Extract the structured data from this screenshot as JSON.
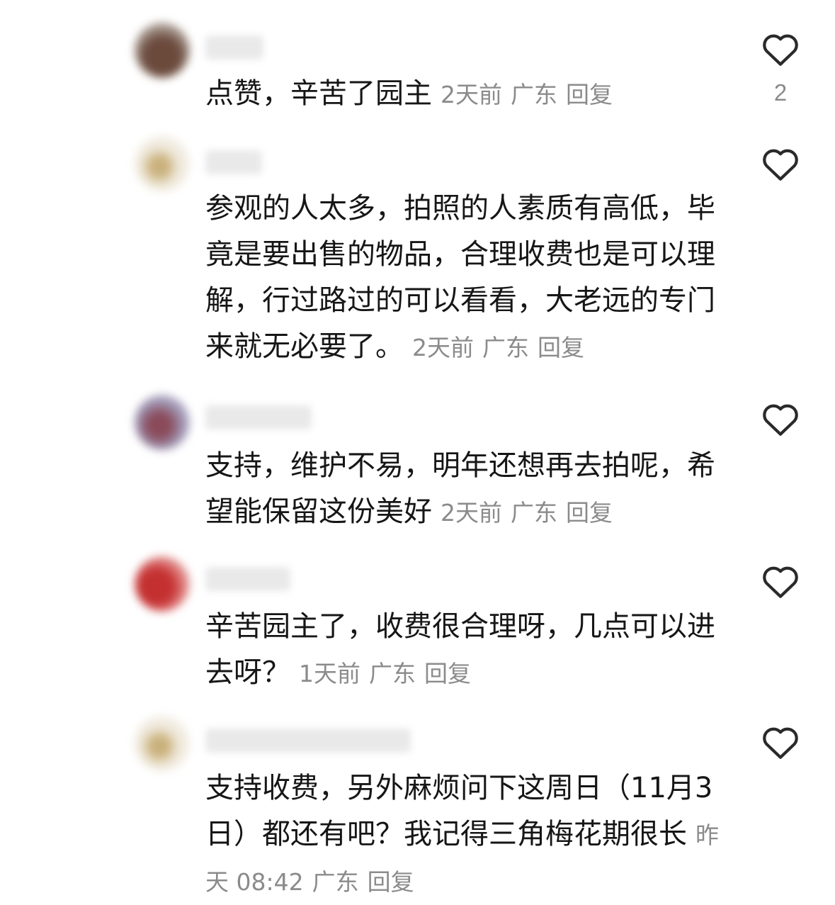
{
  "comments": [
    {
      "text": "点赞，辛苦了园主",
      "time": "2天前",
      "location": "广东",
      "reply_label": "回复",
      "like_count": "2",
      "avatar_color": "#7a5a4a"
    },
    {
      "text": "参观的人太多，拍照的人素质有高低，毕竟是要出售的物品，合理收费也是可以理解，行过路过的可以看看，大老远的专门来就无必要了。",
      "time": "2天前",
      "location": "广东",
      "reply_label": "回复",
      "like_count": "",
      "avatar_color": "#d9c7a0"
    },
    {
      "text": "支持，维护不易，明年还想再去拍呢，希望能保留这份美好",
      "time": "2天前",
      "location": "广东",
      "reply_label": "回复",
      "like_count": "",
      "avatar_color": "#8a6a7a"
    },
    {
      "text": "辛苦园主了，收费很合理呀，几点可以进去呀？",
      "time": "1天前",
      "location": "广东",
      "reply_label": "回复",
      "like_count": "",
      "avatar_color": "#d04040"
    },
    {
      "text": "支持收费，另外麻烦问下这周日（11月3日）都还有吧？我记得三角梅花期很长",
      "time": "昨天 08:42",
      "location": "广东",
      "reply_label": "回复",
      "like_count": "",
      "avatar_color": "#d9c7a0"
    }
  ],
  "icons": {
    "like": "heart-outline-icon"
  },
  "colors": {
    "meta_text": "#8b8b8b",
    "body_text": "#161616",
    "icon_stroke": "#2a2a2a"
  }
}
